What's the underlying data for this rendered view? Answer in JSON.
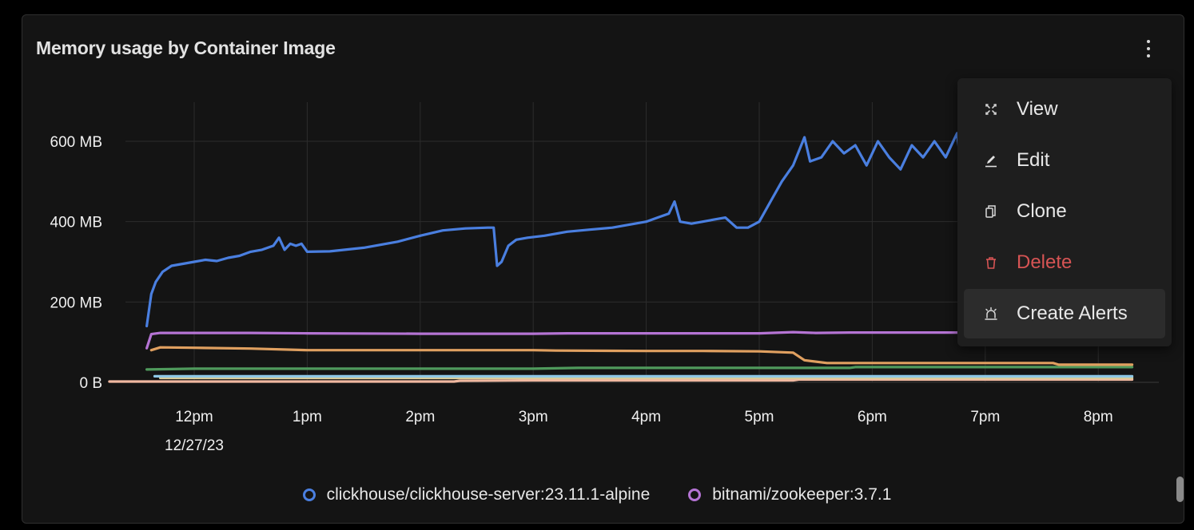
{
  "panel": {
    "title": "Memory usage by Container Image",
    "menu_icon": "kebab-vertical-icon"
  },
  "menu": {
    "items": [
      {
        "label": "View",
        "icon": "expand-icon",
        "variant": "normal"
      },
      {
        "label": "Edit",
        "icon": "pencil-icon",
        "variant": "normal"
      },
      {
        "label": "Clone",
        "icon": "copy-icon",
        "variant": "normal"
      },
      {
        "label": "Delete",
        "icon": "trash-icon",
        "variant": "danger",
        "color": "#d65454"
      },
      {
        "label": "Create Alerts",
        "icon": "siren-icon",
        "variant": "highlighted"
      }
    ]
  },
  "chart_data": {
    "type": "line",
    "title": "Memory usage by Container Image",
    "xlabel": "",
    "ylabel": "",
    "ylim_mb": [
      0,
      700
    ],
    "y_ticks": [
      {
        "value_mb": 0,
        "label": "0 B"
      },
      {
        "value_mb": 200,
        "label": "200 MB"
      },
      {
        "value_mb": 400,
        "label": "400 MB"
      },
      {
        "value_mb": 600,
        "label": "600 MB"
      }
    ],
    "x_range_hours": [
      11.25,
      20.5
    ],
    "x_ticks": [
      {
        "hour": 12,
        "label": "12pm",
        "sublabel": "12/27/23"
      },
      {
        "hour": 13,
        "label": "1pm"
      },
      {
        "hour": 14,
        "label": "2pm"
      },
      {
        "hour": 15,
        "label": "3pm"
      },
      {
        "hour": 16,
        "label": "4pm"
      },
      {
        "hour": 17,
        "label": "5pm"
      },
      {
        "hour": 18,
        "label": "6pm"
      },
      {
        "hour": 19,
        "label": "7pm"
      },
      {
        "hour": 20,
        "label": "8pm"
      }
    ],
    "grid": true,
    "legend_position": "bottom",
    "series": [
      {
        "name": "clickhouse/clickhouse-server:23.11.1-alpine",
        "color": "#4a7fe0",
        "in_legend": true,
        "points": [
          [
            11.58,
            140
          ],
          [
            11.62,
            220
          ],
          [
            11.66,
            250
          ],
          [
            11.72,
            275
          ],
          [
            11.8,
            290
          ],
          [
            11.9,
            295
          ],
          [
            12.0,
            300
          ],
          [
            12.1,
            305
          ],
          [
            12.2,
            302
          ],
          [
            12.3,
            310
          ],
          [
            12.4,
            315
          ],
          [
            12.5,
            325
          ],
          [
            12.6,
            330
          ],
          [
            12.7,
            340
          ],
          [
            12.75,
            360
          ],
          [
            12.8,
            330
          ],
          [
            12.85,
            345
          ],
          [
            12.9,
            340
          ],
          [
            12.95,
            345
          ],
          [
            13.0,
            325
          ],
          [
            13.2,
            326
          ],
          [
            13.5,
            335
          ],
          [
            13.8,
            350
          ],
          [
            14.0,
            365
          ],
          [
            14.2,
            378
          ],
          [
            14.4,
            383
          ],
          [
            14.6,
            385
          ],
          [
            14.65,
            385
          ],
          [
            14.68,
            290
          ],
          [
            14.72,
            300
          ],
          [
            14.78,
            340
          ],
          [
            14.85,
            355
          ],
          [
            14.95,
            360
          ],
          [
            15.1,
            365
          ],
          [
            15.3,
            375
          ],
          [
            15.5,
            380
          ],
          [
            15.7,
            385
          ],
          [
            15.9,
            395
          ],
          [
            16.0,
            400
          ],
          [
            16.1,
            410
          ],
          [
            16.2,
            420
          ],
          [
            16.25,
            450
          ],
          [
            16.3,
            400
          ],
          [
            16.4,
            395
          ],
          [
            16.5,
            400
          ],
          [
            16.6,
            405
          ],
          [
            16.7,
            410
          ],
          [
            16.8,
            385
          ],
          [
            16.9,
            385
          ],
          [
            17.0,
            400
          ],
          [
            17.1,
            450
          ],
          [
            17.2,
            500
          ],
          [
            17.3,
            540
          ],
          [
            17.4,
            610
          ],
          [
            17.45,
            550
          ],
          [
            17.55,
            560
          ],
          [
            17.65,
            600
          ],
          [
            17.75,
            570
          ],
          [
            17.85,
            590
          ],
          [
            17.95,
            540
          ],
          [
            18.05,
            600
          ],
          [
            18.15,
            560
          ],
          [
            18.25,
            530
          ],
          [
            18.35,
            590
          ],
          [
            18.45,
            560
          ],
          [
            18.55,
            600
          ],
          [
            18.65,
            560
          ],
          [
            18.75,
            620
          ],
          [
            18.8,
            510
          ],
          [
            18.9,
            505
          ],
          [
            19.0,
            510
          ],
          [
            19.1,
            540
          ],
          [
            19.2,
            590
          ],
          [
            19.3,
            580
          ],
          [
            19.4,
            600
          ],
          [
            19.5,
            560
          ],
          [
            19.6,
            530
          ],
          [
            19.7,
            510
          ],
          [
            19.8,
            520
          ],
          [
            19.9,
            580
          ],
          [
            20.0,
            600
          ],
          [
            20.05,
            610
          ],
          [
            20.1,
            560
          ],
          [
            20.2,
            530
          ],
          [
            20.25,
            480
          ]
        ],
        "hidden_beyond_hour": 19.75
      },
      {
        "name": "bitnami/zookeeper:3.7.1",
        "color": "#b574d4",
        "in_legend": true,
        "points": [
          [
            11.58,
            85
          ],
          [
            11.62,
            120
          ],
          [
            11.7,
            123
          ],
          [
            12.5,
            123
          ],
          [
            13.0,
            122
          ],
          [
            14.0,
            121
          ],
          [
            15.0,
            121
          ],
          [
            15.3,
            122
          ],
          [
            16.0,
            122
          ],
          [
            17.0,
            122
          ],
          [
            17.3,
            125
          ],
          [
            17.5,
            123
          ],
          [
            17.8,
            124
          ],
          [
            18.5,
            124
          ],
          [
            19.5,
            124
          ],
          [
            19.8,
            124
          ]
        ]
      },
      {
        "name": "series-3",
        "color": "#e0a060",
        "in_legend": false,
        "points": [
          [
            11.62,
            80
          ],
          [
            11.7,
            87
          ],
          [
            12.0,
            86
          ],
          [
            12.5,
            84
          ],
          [
            13.0,
            80
          ],
          [
            14.0,
            80
          ],
          [
            15.0,
            80
          ],
          [
            15.2,
            79
          ],
          [
            16.0,
            78
          ],
          [
            16.5,
            78
          ],
          [
            17.0,
            77
          ],
          [
            17.3,
            74
          ],
          [
            17.4,
            55
          ],
          [
            17.6,
            48
          ],
          [
            18.0,
            48
          ],
          [
            19.0,
            48
          ],
          [
            19.6,
            48
          ],
          [
            19.65,
            44
          ],
          [
            20.0,
            44
          ],
          [
            20.3,
            44
          ]
        ]
      },
      {
        "name": "series-4",
        "color": "#4f9a5c",
        "in_legend": false,
        "points": [
          [
            11.58,
            32
          ],
          [
            11.8,
            33
          ],
          [
            12.0,
            34
          ],
          [
            15.0,
            34
          ],
          [
            15.4,
            36
          ],
          [
            17.0,
            36
          ],
          [
            17.8,
            36
          ],
          [
            17.85,
            38
          ],
          [
            19.0,
            38
          ],
          [
            20.3,
            38
          ]
        ]
      },
      {
        "name": "series-5",
        "color": "#8ec8e6",
        "in_legend": false,
        "points": [
          [
            11.65,
            15
          ],
          [
            20.3,
            15
          ]
        ]
      },
      {
        "name": "series-6",
        "color": "#d8cc9a",
        "in_legend": false,
        "points": [
          [
            11.7,
            11
          ],
          [
            20.3,
            11
          ]
        ]
      },
      {
        "name": "series-7",
        "color": "#f0b8a0",
        "in_legend": false,
        "points": [
          [
            11.25,
            2
          ],
          [
            14.3,
            2
          ],
          [
            14.35,
            4
          ],
          [
            15.0,
            5
          ],
          [
            17.3,
            5
          ],
          [
            17.35,
            7
          ],
          [
            20.3,
            7
          ]
        ]
      }
    ]
  },
  "legend": {
    "items": [
      {
        "label": "clickhouse/clickhouse-server:23.11.1-alpine",
        "color": "#4a7fe0"
      },
      {
        "label": "bitnami/zookeeper:3.7.1",
        "color": "#b574d4"
      }
    ]
  }
}
